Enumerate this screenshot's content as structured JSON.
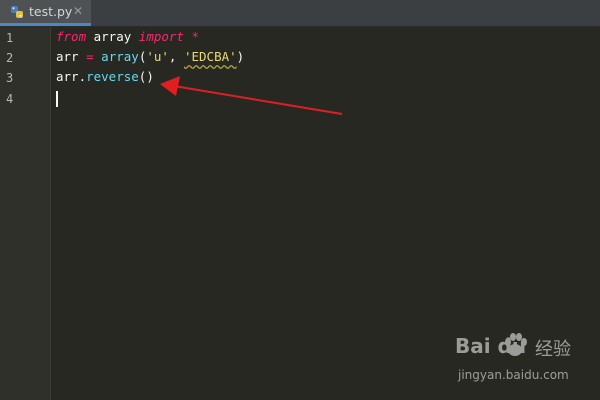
{
  "tab": {
    "filename": "test.py",
    "close_glyph": "✕",
    "icon": "python-file-icon"
  },
  "editor": {
    "line_numbers": [
      "1",
      "2",
      "3",
      "4"
    ],
    "current_line": 4,
    "lines": [
      {
        "tokens": [
          {
            "t": "from",
            "c": "kw"
          },
          {
            "t": " array ",
            "c": "plain"
          },
          {
            "t": "import",
            "c": "kw"
          },
          {
            "t": " *",
            "c": "op"
          }
        ]
      },
      {
        "tokens": [
          {
            "t": "arr ",
            "c": "plain"
          },
          {
            "t": "=",
            "c": "op"
          },
          {
            "t": " ",
            "c": "plain"
          },
          {
            "t": "array",
            "c": "builtin"
          },
          {
            "t": "(",
            "c": "plain"
          },
          {
            "t": "'u'",
            "c": "str"
          },
          {
            "t": ", ",
            "c": "plain"
          },
          {
            "t": "'EDCBA'",
            "c": "str squiggle"
          },
          {
            "t": ")",
            "c": "plain"
          }
        ]
      },
      {
        "tokens": [
          {
            "t": "arr.",
            "c": "plain"
          },
          {
            "t": "reverse",
            "c": "builtin"
          },
          {
            "t": "()",
            "c": "plain"
          }
        ]
      },
      {
        "tokens": []
      }
    ]
  },
  "annotation": {
    "type": "arrow",
    "color": "#e02020",
    "points_to": "reverse()"
  },
  "watermark": {
    "brand_logo": "Bai du",
    "brand_suffix": "经验",
    "url": "jingyan.baidu.com"
  },
  "colors": {
    "background": "#272822",
    "keyword": "#f92672",
    "builtin": "#66d9ef",
    "string": "#e6db74",
    "tab_accent": "#4a88c7"
  }
}
